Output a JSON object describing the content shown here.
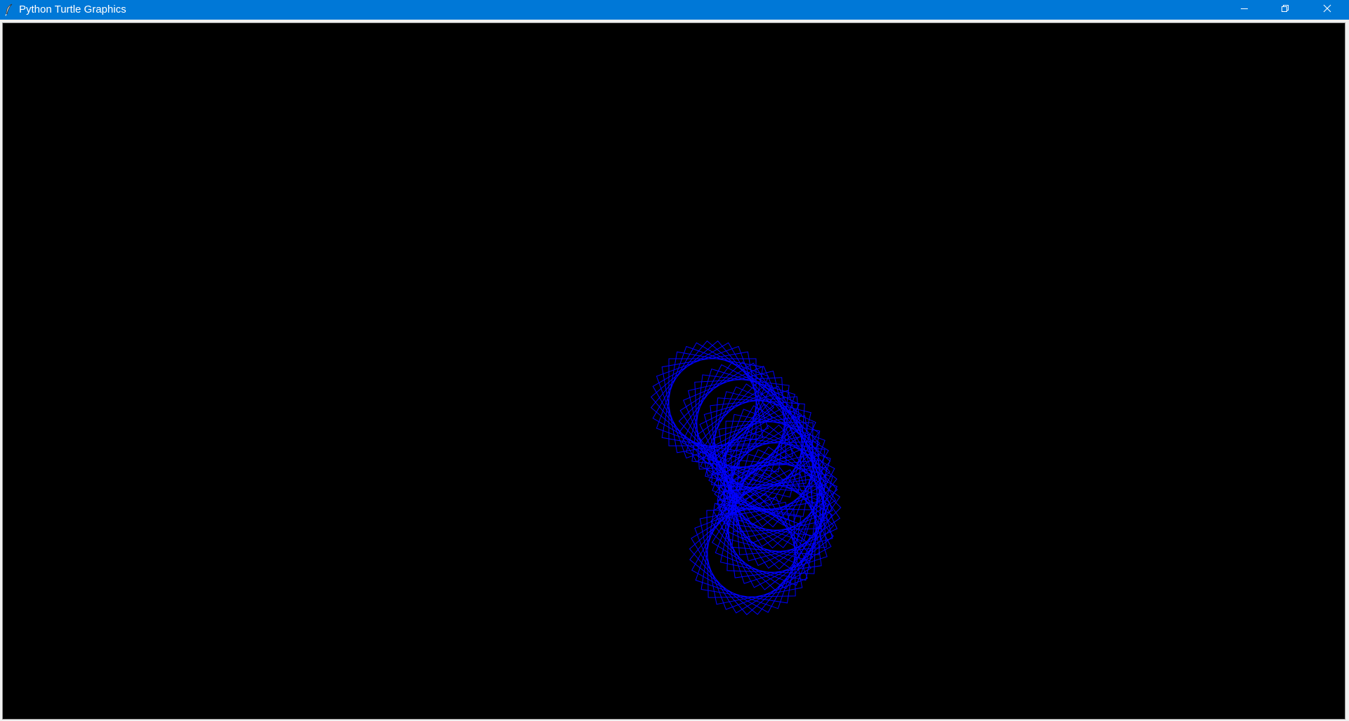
{
  "window": {
    "title": "Python Turtle Graphics",
    "app_icon": "feather-icon",
    "titlebar_color": "#0078d7",
    "title_text_color": "#ffffff",
    "controls": {
      "minimize_icon": "minimize-icon",
      "maximize_icon": "restore-icon",
      "close_icon": "close-icon"
    }
  },
  "canvas": {
    "background": "#000000",
    "pen_color": "#0000ff",
    "drawing": "spirograph"
  }
}
